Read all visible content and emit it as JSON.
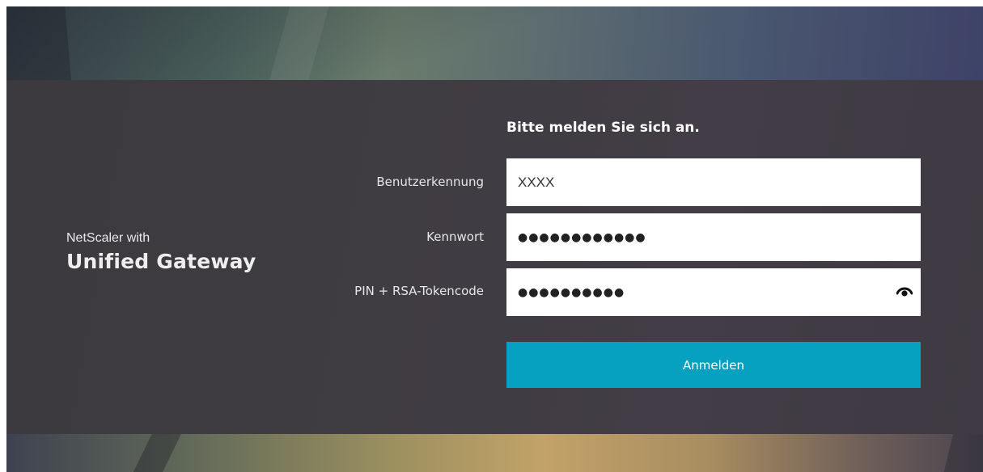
{
  "brand": {
    "line1": "NetScaler with",
    "line2": "Unified Gateway"
  },
  "form": {
    "title": "Bitte melden Sie sich an.",
    "username": {
      "label": "Benutzerkennung",
      "value": "XXXX"
    },
    "password": {
      "label": "Kennwort",
      "masked_value": "●●●●●●●●●●●●"
    },
    "pin": {
      "label": "PIN + RSA-Tokencode",
      "masked_value": "●●●●●●●●●●",
      "toggle_icon": "eye-icon"
    },
    "submit_label": "Anmelden"
  },
  "colors": {
    "accent": "#06a0c0",
    "panel": "#3f3c42"
  }
}
